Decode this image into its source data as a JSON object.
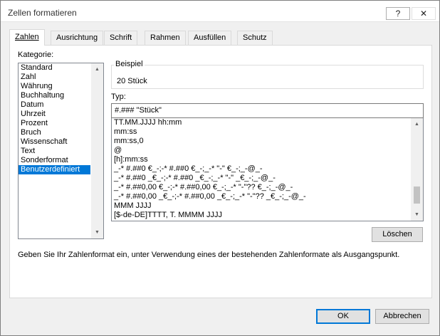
{
  "window": {
    "title": "Zellen formatieren",
    "help_label": "?",
    "close_label": "✕"
  },
  "tabs": [
    {
      "label": "Zahlen",
      "active": true
    },
    {
      "label": "Ausrichtung"
    },
    {
      "label": "Schrift"
    },
    {
      "label": "Rahmen"
    },
    {
      "label": "Ausfüllen"
    },
    {
      "label": "Schutz"
    }
  ],
  "category": {
    "label": "Kategorie:",
    "items": [
      "Standard",
      "Zahl",
      "Währung",
      "Buchhaltung",
      "Datum",
      "Uhrzeit",
      "Prozent",
      "Bruch",
      "Wissenschaft",
      "Text",
      "Sonderformat",
      "Benutzerdefiniert"
    ],
    "selected": "Benutzerdefiniert"
  },
  "sample": {
    "label": "Beispiel",
    "value": "20 Stück"
  },
  "type": {
    "label": "Typ:",
    "value": "#.### \"Stück\""
  },
  "formats": [
    "TT.MM.JJJJ hh:mm",
    "mm:ss",
    "mm:ss,0",
    "@",
    "[h]:mm:ss",
    "_-* #.##0 €_-;-* #.##0 €_-;_-* \"-\" €_-;_-@_-",
    "_-* #.##0 _€_-;-* #.##0 _€_-;_-* \"-\" _€_-;_-@_-",
    "_-* #.##0,00 €_-;-* #.##0,00 €_-;_-* \"-\"?? €_-;_-@_-",
    "_-* #.##0,00 _€_-;-* #.##0,00 _€_-;_-* \"-\"?? _€_-;_-@_-",
    "MMM JJJJ",
    "[$-de-DE]TTTT, T. MMMM JJJJ"
  ],
  "buttons": {
    "delete": "Löschen",
    "ok": "OK",
    "cancel": "Abbrechen"
  },
  "hint": "Geben Sie Ihr Zahlenformat ein, unter Verwendung eines der bestehenden Zahlenformate als Ausgangspunkt.",
  "icons": {
    "scroll_up": "▲",
    "scroll_down": "▼"
  },
  "colors": {
    "selection": "#0078d7",
    "dialog_bg": "#f0f0f0"
  }
}
